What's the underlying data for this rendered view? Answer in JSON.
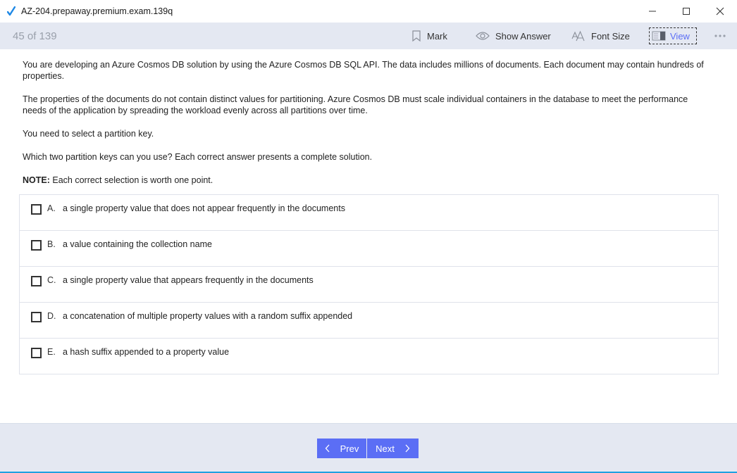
{
  "window": {
    "title": "AZ-204.prepaway.premium.exam.139q",
    "controls": [
      "minimize",
      "maximize",
      "close"
    ]
  },
  "toolbar": {
    "counter": "45 of 139",
    "mark_label": "Mark",
    "show_answer_label": "Show Answer",
    "font_size_label": "Font Size",
    "view_label": "View",
    "more_label": "•••"
  },
  "question": {
    "paragraphs": [
      "You are developing an Azure Cosmos DB solution by using the Azure Cosmos DB SQL API. The data includes millions of documents. Each document may contain hundreds of properties.",
      "The properties of the documents do not contain distinct values for partitioning. Azure Cosmos DB must scale individual containers in the database to meet the performance needs of the application by spreading the workload evenly across all partitions over time.",
      "You need to select a partition key.",
      "Which two partition keys can you use? Each correct answer presents a complete solution."
    ],
    "note_label": "NOTE:",
    "note_text": " Each correct selection is worth one point."
  },
  "options": [
    {
      "letter": "A.",
      "text": "a single property value that does not appear frequently in the documents",
      "checked": false
    },
    {
      "letter": "B.",
      "text": "a value containing the collection name",
      "checked": false
    },
    {
      "letter": "C.",
      "text": "a single property value that appears frequently in the documents",
      "checked": false
    },
    {
      "letter": "D.",
      "text": "a concatenation of multiple property values with a random suffix appended",
      "checked": false
    },
    {
      "letter": "E.",
      "text": "a hash suffix appended to a property value",
      "checked": false
    }
  ],
  "navigation": {
    "prev_label": "Prev",
    "next_label": "Next"
  },
  "colors": {
    "accent": "#5b6ef5",
    "toolbar_bg": "#e4e8f2",
    "app_icon": "#1e88e5"
  }
}
